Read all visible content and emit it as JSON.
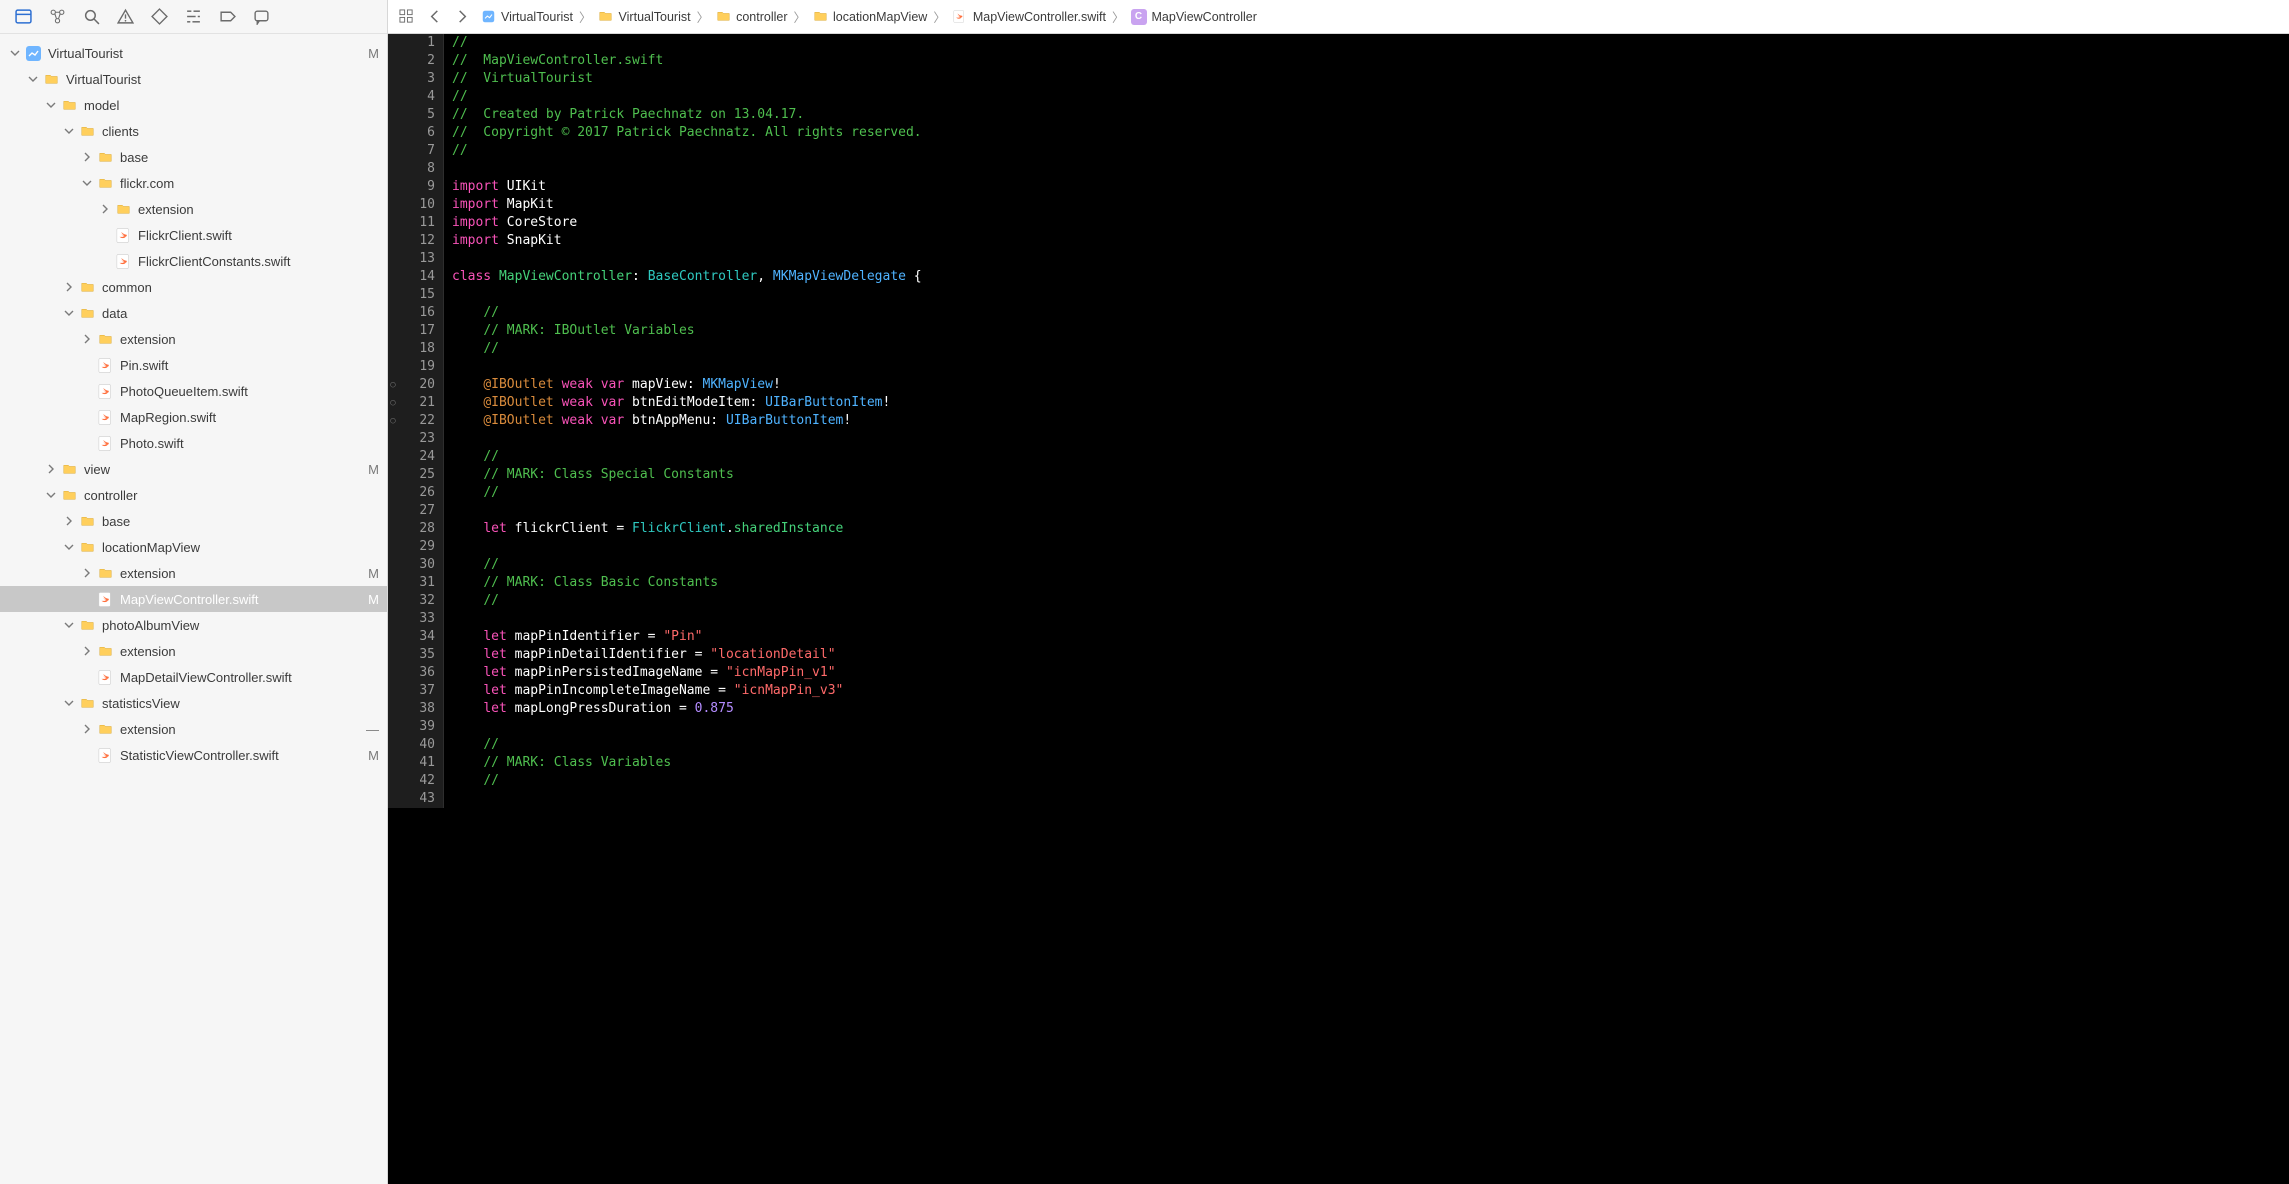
{
  "toolbar_icons": [
    "files",
    "symbols",
    "search",
    "warnings",
    "tests",
    "debug",
    "breakpoints",
    "chat"
  ],
  "breadcrumbs": [
    {
      "icon": "proj",
      "label": "VirtualTourist"
    },
    {
      "icon": "folder",
      "label": "VirtualTourist"
    },
    {
      "icon": "folder",
      "label": "controller"
    },
    {
      "icon": "folder",
      "label": "locationMapView"
    },
    {
      "icon": "swift",
      "label": "MapViewController.swift"
    },
    {
      "icon": "class",
      "label": "MapViewController"
    }
  ],
  "tree": [
    {
      "d": 0,
      "disc": "down",
      "icon": "proj",
      "label": "VirtualTourist",
      "status": "M"
    },
    {
      "d": 1,
      "disc": "down",
      "icon": "folder",
      "label": "VirtualTourist"
    },
    {
      "d": 2,
      "disc": "down",
      "icon": "folder",
      "label": "model"
    },
    {
      "d": 3,
      "disc": "down",
      "icon": "folder",
      "label": "clients"
    },
    {
      "d": 4,
      "disc": "right",
      "icon": "folder",
      "label": "base"
    },
    {
      "d": 4,
      "disc": "down",
      "icon": "folder",
      "label": "flickr.com"
    },
    {
      "d": 5,
      "disc": "right",
      "icon": "folder",
      "label": "extension"
    },
    {
      "d": 5,
      "disc": "none",
      "icon": "swift",
      "label": "FlickrClient.swift"
    },
    {
      "d": 5,
      "disc": "none",
      "icon": "swift",
      "label": "FlickrClientConstants.swift"
    },
    {
      "d": 3,
      "disc": "right",
      "icon": "folder",
      "label": "common"
    },
    {
      "d": 3,
      "disc": "down",
      "icon": "folder",
      "label": "data"
    },
    {
      "d": 4,
      "disc": "right",
      "icon": "folder",
      "label": "extension"
    },
    {
      "d": 4,
      "disc": "none",
      "icon": "swift",
      "label": "Pin.swift"
    },
    {
      "d": 4,
      "disc": "none",
      "icon": "swift",
      "label": "PhotoQueueItem.swift"
    },
    {
      "d": 4,
      "disc": "none",
      "icon": "swift",
      "label": "MapRegion.swift"
    },
    {
      "d": 4,
      "disc": "none",
      "icon": "swift",
      "label": "Photo.swift"
    },
    {
      "d": 2,
      "disc": "right",
      "icon": "folder",
      "label": "view",
      "status": "M"
    },
    {
      "d": 2,
      "disc": "down",
      "icon": "folder",
      "label": "controller"
    },
    {
      "d": 3,
      "disc": "right",
      "icon": "folder",
      "label": "base"
    },
    {
      "d": 3,
      "disc": "down",
      "icon": "folder",
      "label": "locationMapView"
    },
    {
      "d": 4,
      "disc": "right",
      "icon": "folder",
      "label": "extension",
      "status": "M"
    },
    {
      "d": 4,
      "disc": "none",
      "icon": "swift",
      "label": "MapViewController.swift",
      "status": "M",
      "selected": true
    },
    {
      "d": 3,
      "disc": "down",
      "icon": "folder",
      "label": "photoAlbumView"
    },
    {
      "d": 4,
      "disc": "right",
      "icon": "folder",
      "label": "extension"
    },
    {
      "d": 4,
      "disc": "none",
      "icon": "swift",
      "label": "MapDetailViewController.swift"
    },
    {
      "d": 3,
      "disc": "down",
      "icon": "folder",
      "label": "statisticsView"
    },
    {
      "d": 4,
      "disc": "right",
      "icon": "folder",
      "label": "extension",
      "status": "—"
    },
    {
      "d": 4,
      "disc": "none",
      "icon": "swift",
      "label": "StatisticViewController.swift",
      "status": "M"
    }
  ],
  "ib_markers": [
    20,
    21,
    22
  ],
  "code": [
    {
      "n": 1,
      "t": [
        [
          "comment",
          "//"
        ]
      ]
    },
    {
      "n": 2,
      "t": [
        [
          "comment",
          "//  MapViewController.swift"
        ]
      ]
    },
    {
      "n": 3,
      "t": [
        [
          "comment",
          "//  VirtualTourist"
        ]
      ]
    },
    {
      "n": 4,
      "t": [
        [
          "comment",
          "//"
        ]
      ]
    },
    {
      "n": 5,
      "t": [
        [
          "comment",
          "//  Created by Patrick Paechnatz on 13.04.17."
        ]
      ]
    },
    {
      "n": 6,
      "t": [
        [
          "comment",
          "//  Copyright © 2017 Patrick Paechnatz. All rights reserved."
        ]
      ]
    },
    {
      "n": 7,
      "t": [
        [
          "comment",
          "//"
        ]
      ]
    },
    {
      "n": 8,
      "t": []
    },
    {
      "n": 9,
      "t": [
        [
          "keyword",
          "import"
        ],
        [
          "white",
          " UIKit"
        ]
      ]
    },
    {
      "n": 10,
      "t": [
        [
          "keyword",
          "import"
        ],
        [
          "white",
          " MapKit"
        ]
      ]
    },
    {
      "n": 11,
      "t": [
        [
          "keyword",
          "import"
        ],
        [
          "white",
          " CoreStore"
        ]
      ]
    },
    {
      "n": 12,
      "t": [
        [
          "keyword",
          "import"
        ],
        [
          "white",
          " SnapKit"
        ]
      ]
    },
    {
      "n": 13,
      "t": []
    },
    {
      "n": 14,
      "t": [
        [
          "keyword",
          "class"
        ],
        [
          "white",
          " "
        ],
        [
          "ident",
          "MapViewController"
        ],
        [
          "white",
          ": "
        ],
        [
          "type",
          "BaseController"
        ],
        [
          "white",
          ", "
        ],
        [
          "prop",
          "MKMapViewDelegate"
        ],
        [
          "white",
          " {"
        ]
      ]
    },
    {
      "n": 15,
      "t": []
    },
    {
      "n": 16,
      "t": [
        [
          "white",
          "    "
        ],
        [
          "comment",
          "//"
        ]
      ]
    },
    {
      "n": 17,
      "t": [
        [
          "white",
          "    "
        ],
        [
          "comment",
          "// MARK: IBOutlet Variables"
        ]
      ]
    },
    {
      "n": 18,
      "t": [
        [
          "white",
          "    "
        ],
        [
          "comment",
          "//"
        ]
      ]
    },
    {
      "n": 19,
      "t": []
    },
    {
      "n": 20,
      "t": [
        [
          "white",
          "    "
        ],
        [
          "decor",
          "@IBOutlet"
        ],
        [
          "white",
          " "
        ],
        [
          "keyword",
          "weak var"
        ],
        [
          "white",
          " mapView: "
        ],
        [
          "prop",
          "MKMapView"
        ],
        [
          "white",
          "!"
        ]
      ]
    },
    {
      "n": 21,
      "t": [
        [
          "white",
          "    "
        ],
        [
          "decor",
          "@IBOutlet"
        ],
        [
          "white",
          " "
        ],
        [
          "keyword",
          "weak var"
        ],
        [
          "white",
          " btnEditModeItem: "
        ],
        [
          "prop",
          "UIBarButtonItem"
        ],
        [
          "white",
          "!"
        ]
      ]
    },
    {
      "n": 22,
      "t": [
        [
          "white",
          "    "
        ],
        [
          "decor",
          "@IBOutlet"
        ],
        [
          "white",
          " "
        ],
        [
          "keyword",
          "weak var"
        ],
        [
          "white",
          " btnAppMenu: "
        ],
        [
          "prop",
          "UIBarButtonItem"
        ],
        [
          "white",
          "!"
        ]
      ]
    },
    {
      "n": 23,
      "t": []
    },
    {
      "n": 24,
      "t": [
        [
          "white",
          "    "
        ],
        [
          "comment",
          "//"
        ]
      ]
    },
    {
      "n": 25,
      "t": [
        [
          "white",
          "    "
        ],
        [
          "comment",
          "// MARK: Class Special Constants"
        ]
      ]
    },
    {
      "n": 26,
      "t": [
        [
          "white",
          "    "
        ],
        [
          "comment",
          "//"
        ]
      ]
    },
    {
      "n": 27,
      "t": []
    },
    {
      "n": 28,
      "t": [
        [
          "white",
          "    "
        ],
        [
          "keyword",
          "let"
        ],
        [
          "white",
          " flickrClient = "
        ],
        [
          "type",
          "FlickrClient"
        ],
        [
          "white",
          "."
        ],
        [
          "ident",
          "sharedInstance"
        ]
      ]
    },
    {
      "n": 29,
      "t": []
    },
    {
      "n": 30,
      "t": [
        [
          "white",
          "    "
        ],
        [
          "comment",
          "//"
        ]
      ]
    },
    {
      "n": 31,
      "t": [
        [
          "white",
          "    "
        ],
        [
          "comment",
          "// MARK: Class Basic Constants"
        ]
      ]
    },
    {
      "n": 32,
      "t": [
        [
          "white",
          "    "
        ],
        [
          "comment",
          "//"
        ]
      ]
    },
    {
      "n": 33,
      "t": []
    },
    {
      "n": 34,
      "t": [
        [
          "white",
          "    "
        ],
        [
          "keyword",
          "let"
        ],
        [
          "white",
          " mapPinIdentifier = "
        ],
        [
          "string",
          "\"Pin\""
        ]
      ]
    },
    {
      "n": 35,
      "t": [
        [
          "white",
          "    "
        ],
        [
          "keyword",
          "let"
        ],
        [
          "white",
          " mapPinDetailIdentifier = "
        ],
        [
          "string",
          "\"locationDetail\""
        ]
      ]
    },
    {
      "n": 36,
      "t": [
        [
          "white",
          "    "
        ],
        [
          "keyword",
          "let"
        ],
        [
          "white",
          " mapPinPersistedImageName = "
        ],
        [
          "string",
          "\"icnMapPin_v1\""
        ]
      ]
    },
    {
      "n": 37,
      "t": [
        [
          "white",
          "    "
        ],
        [
          "keyword",
          "let"
        ],
        [
          "white",
          " mapPinIncompleteImageName = "
        ],
        [
          "string",
          "\"icnMapPin_v3\""
        ]
      ]
    },
    {
      "n": 38,
      "t": [
        [
          "white",
          "    "
        ],
        [
          "keyword",
          "let"
        ],
        [
          "white",
          " mapLongPressDuration = "
        ],
        [
          "num",
          "0.875"
        ]
      ]
    },
    {
      "n": 39,
      "t": []
    },
    {
      "n": 40,
      "t": [
        [
          "white",
          "    "
        ],
        [
          "comment",
          "//"
        ]
      ]
    },
    {
      "n": 41,
      "t": [
        [
          "white",
          "    "
        ],
        [
          "comment",
          "// MARK: Class Variables"
        ]
      ]
    },
    {
      "n": 42,
      "t": [
        [
          "white",
          "    "
        ],
        [
          "comment",
          "//"
        ]
      ]
    },
    {
      "n": 43,
      "t": []
    }
  ]
}
